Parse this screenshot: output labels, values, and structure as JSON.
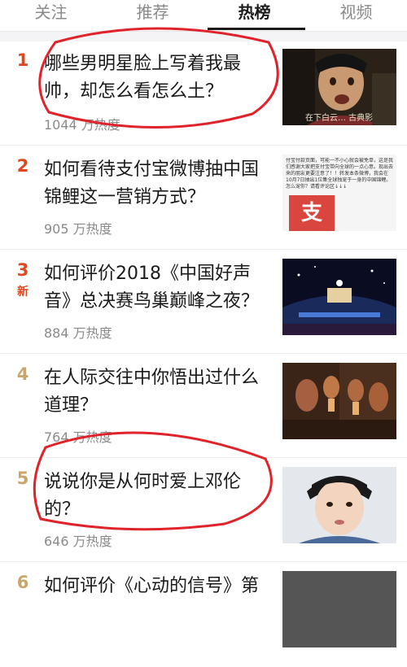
{
  "tabs": [
    {
      "label": "关注"
    },
    {
      "label": "推荐"
    },
    {
      "label": "热榜"
    },
    {
      "label": "视频"
    }
  ],
  "active_tab": "热榜",
  "items": [
    {
      "rank": "1",
      "title": "哪些男明星脸上写着我最帅，却怎么看怎么土？",
      "heat": "1044 万热度",
      "new_label": "",
      "thumb_icon": "man-photo",
      "thumb_text": "在下白云… 古典影",
      "rank_color": "#e0461f"
    },
    {
      "rank": "2",
      "title": "如何看待支付宝微博抽中国锦鲤这一营销方式？",
      "heat": "905 万热度",
      "new_label": "",
      "thumb_icon": "alipay-screenshot",
      "thumb_text": "付宝付款页面，可能一不小心就会被免单，这是我们感谢大家把支付宝带向全球的一点心意。现出去来的朋友更要注意了！！转发本条微博，我会在10月7日抽出1位集全球独宠于一身的中国锦鲤。怎么宠你？请看评论区↓↓↓",
      "thumb_logo": "支",
      "rank_color": "#e0461f"
    },
    {
      "rank": "3",
      "title": "如何评价2018《中国好声音》总决赛鸟巢巅峰之夜？",
      "heat": "884 万热度",
      "new_label": "新",
      "thumb_icon": "stadium-concert-photo",
      "rank_color": "#e0461f"
    },
    {
      "rank": "4",
      "title": "在人际交往中你悟出过什么道理？",
      "heat": "764 万热度",
      "new_label": "",
      "thumb_icon": "party-drinks-photo",
      "rank_color": "#c9a66b"
    },
    {
      "rank": "5",
      "title": "说说你是从何时爱上邓伦的？",
      "heat": "646 万热度",
      "new_label": "",
      "thumb_icon": "actor-portrait-photo",
      "rank_color": "#c9a66b"
    },
    {
      "rank": "6",
      "title": "如何评价《心动的信号》第",
      "heat": "",
      "new_label": "",
      "thumb_icon": "show-photo",
      "rank_color": "#c9a66b"
    }
  ],
  "colors": {
    "hot_rank": "#e0461f",
    "normal_rank": "#c9a66b",
    "annotation": "#e0232b"
  }
}
